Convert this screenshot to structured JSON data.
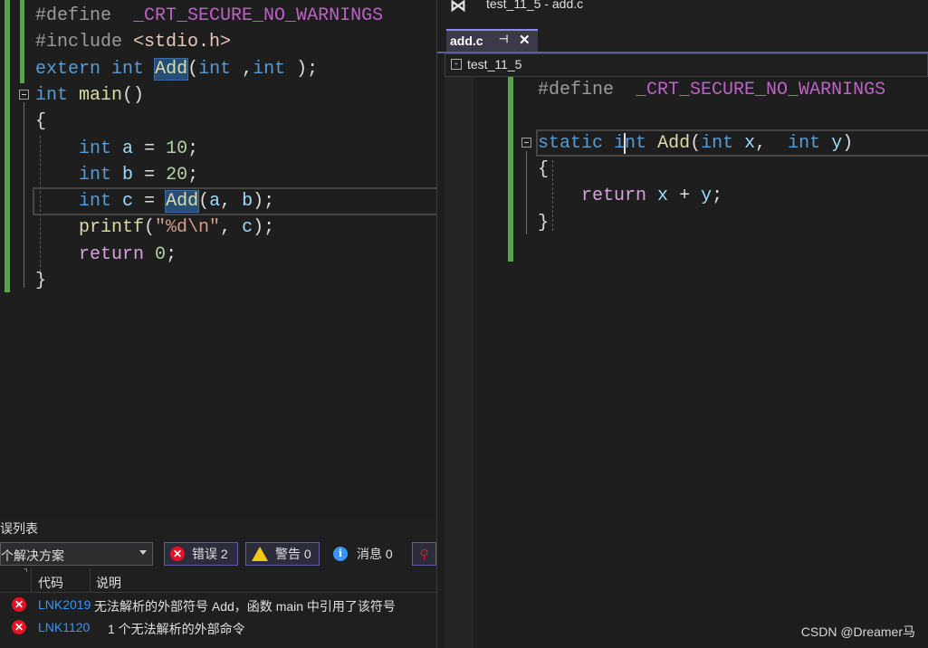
{
  "left_editor": {
    "lines": [
      {
        "tokens": [
          [
            "pp",
            "#define"
          ],
          [
            "txt",
            "  "
          ],
          [
            "mac",
            "_CRT_SECURE_NO_WARNINGS"
          ]
        ]
      },
      {
        "tokens": [
          [
            "pp",
            "#include "
          ],
          [
            "inc",
            "<stdio.h>"
          ]
        ]
      },
      {
        "tokens": [
          [
            "kw",
            "extern"
          ],
          [
            "txt",
            " "
          ],
          [
            "kw",
            "int"
          ],
          [
            "txt",
            " "
          ],
          [
            "fnhl",
            "Add"
          ],
          [
            "txt",
            "("
          ],
          [
            "kw",
            "int"
          ],
          [
            "txt",
            " ,"
          ],
          [
            "kw",
            "int"
          ],
          [
            "txt",
            " );"
          ]
        ]
      },
      {
        "tokens": [
          [
            "kw",
            "int"
          ],
          [
            "txt",
            " "
          ],
          [
            "fn",
            "main"
          ],
          [
            "txt",
            "()"
          ]
        ]
      },
      {
        "tokens": [
          [
            "txt",
            "{"
          ]
        ]
      },
      {
        "tokens": [
          [
            "txt",
            "    "
          ],
          [
            "kw",
            "int"
          ],
          [
            "txt",
            " "
          ],
          [
            "var",
            "a"
          ],
          [
            "txt",
            " = "
          ],
          [
            "num",
            "10"
          ],
          [
            "txt",
            ";"
          ]
        ]
      },
      {
        "tokens": [
          [
            "txt",
            "    "
          ],
          [
            "kw",
            "int"
          ],
          [
            "txt",
            " "
          ],
          [
            "var",
            "b"
          ],
          [
            "txt",
            " = "
          ],
          [
            "num",
            "20"
          ],
          [
            "txt",
            ";"
          ]
        ]
      },
      {
        "tokens": [
          [
            "txt",
            "    "
          ],
          [
            "kw",
            "int"
          ],
          [
            "txt",
            " "
          ],
          [
            "var",
            "c"
          ],
          [
            "txt",
            " = "
          ],
          [
            "fnhl",
            "Add"
          ],
          [
            "txt",
            "("
          ],
          [
            "var",
            "a"
          ],
          [
            "txt",
            ", "
          ],
          [
            "var",
            "b"
          ],
          [
            "txt",
            ");"
          ]
        ]
      },
      {
        "tokens": [
          [
            "txt",
            "    "
          ],
          [
            "fn",
            "printf"
          ],
          [
            "txt",
            "("
          ],
          [
            "str",
            "\"%d\\n\""
          ],
          [
            "txt",
            ", "
          ],
          [
            "var",
            "c"
          ],
          [
            "txt",
            ");"
          ]
        ]
      },
      {
        "tokens": [
          [
            "txt",
            "    "
          ],
          [
            "ctl",
            "return"
          ],
          [
            "txt",
            " "
          ],
          [
            "num",
            "0"
          ],
          [
            "txt",
            ";"
          ]
        ]
      },
      {
        "tokens": [
          [
            "txt",
            "}"
          ]
        ]
      }
    ]
  },
  "error_list": {
    "title": "误列表",
    "scope_dropdown": "个解决方案",
    "errors_btn": "错误 2",
    "warnings_btn": "警告 0",
    "messages_btn": "消息 0",
    "col_code": "代码",
    "col_desc": "说明",
    "rows": [
      {
        "code": "LNK2019",
        "desc": "无法解析的外部符号 Add，函数 main 中引用了该符号"
      },
      {
        "code": "LNK1120",
        "desc": "1 个无法解析的外部命令"
      }
    ]
  },
  "right_editor": {
    "window_title": "test_11_5 - add.c",
    "tab_label": "add.c",
    "nav_project": "test_11_5",
    "lines": [
      {
        "tokens": [
          [
            "pp",
            "#define"
          ],
          [
            "txt",
            "  "
          ],
          [
            "mac",
            "_CRT_SECURE_NO_WARNINGS"
          ]
        ]
      },
      {
        "tokens": []
      },
      {
        "tokens": [
          [
            "kw",
            "static"
          ],
          [
            "txt",
            " "
          ],
          [
            "kw",
            "int"
          ],
          [
            "txt",
            " "
          ],
          [
            "fn",
            "Add"
          ],
          [
            "txt",
            "("
          ],
          [
            "kw",
            "int"
          ],
          [
            "txt",
            " "
          ],
          [
            "var",
            "x"
          ],
          [
            "txt",
            ",  "
          ],
          [
            "kw",
            "int"
          ],
          [
            "txt",
            " "
          ],
          [
            "var",
            "y"
          ],
          [
            "txt",
            ")"
          ]
        ]
      },
      {
        "tokens": [
          [
            "txt",
            "{"
          ]
        ]
      },
      {
        "tokens": [
          [
            "txt",
            "    "
          ],
          [
            "ctl",
            "return"
          ],
          [
            "txt",
            " "
          ],
          [
            "var",
            "x"
          ],
          [
            "txt",
            " + "
          ],
          [
            "var",
            "y"
          ],
          [
            "txt",
            ";"
          ]
        ]
      },
      {
        "tokens": [
          [
            "txt",
            "}"
          ]
        ]
      }
    ]
  },
  "watermark": "CSDN @Dreamer马",
  "colors": {
    "accent": "#5e5ea6",
    "gutter_green": "#57a64a",
    "error_red": "#e81123",
    "warn_yellow": "#f2c811",
    "info_blue": "#3794ff"
  }
}
